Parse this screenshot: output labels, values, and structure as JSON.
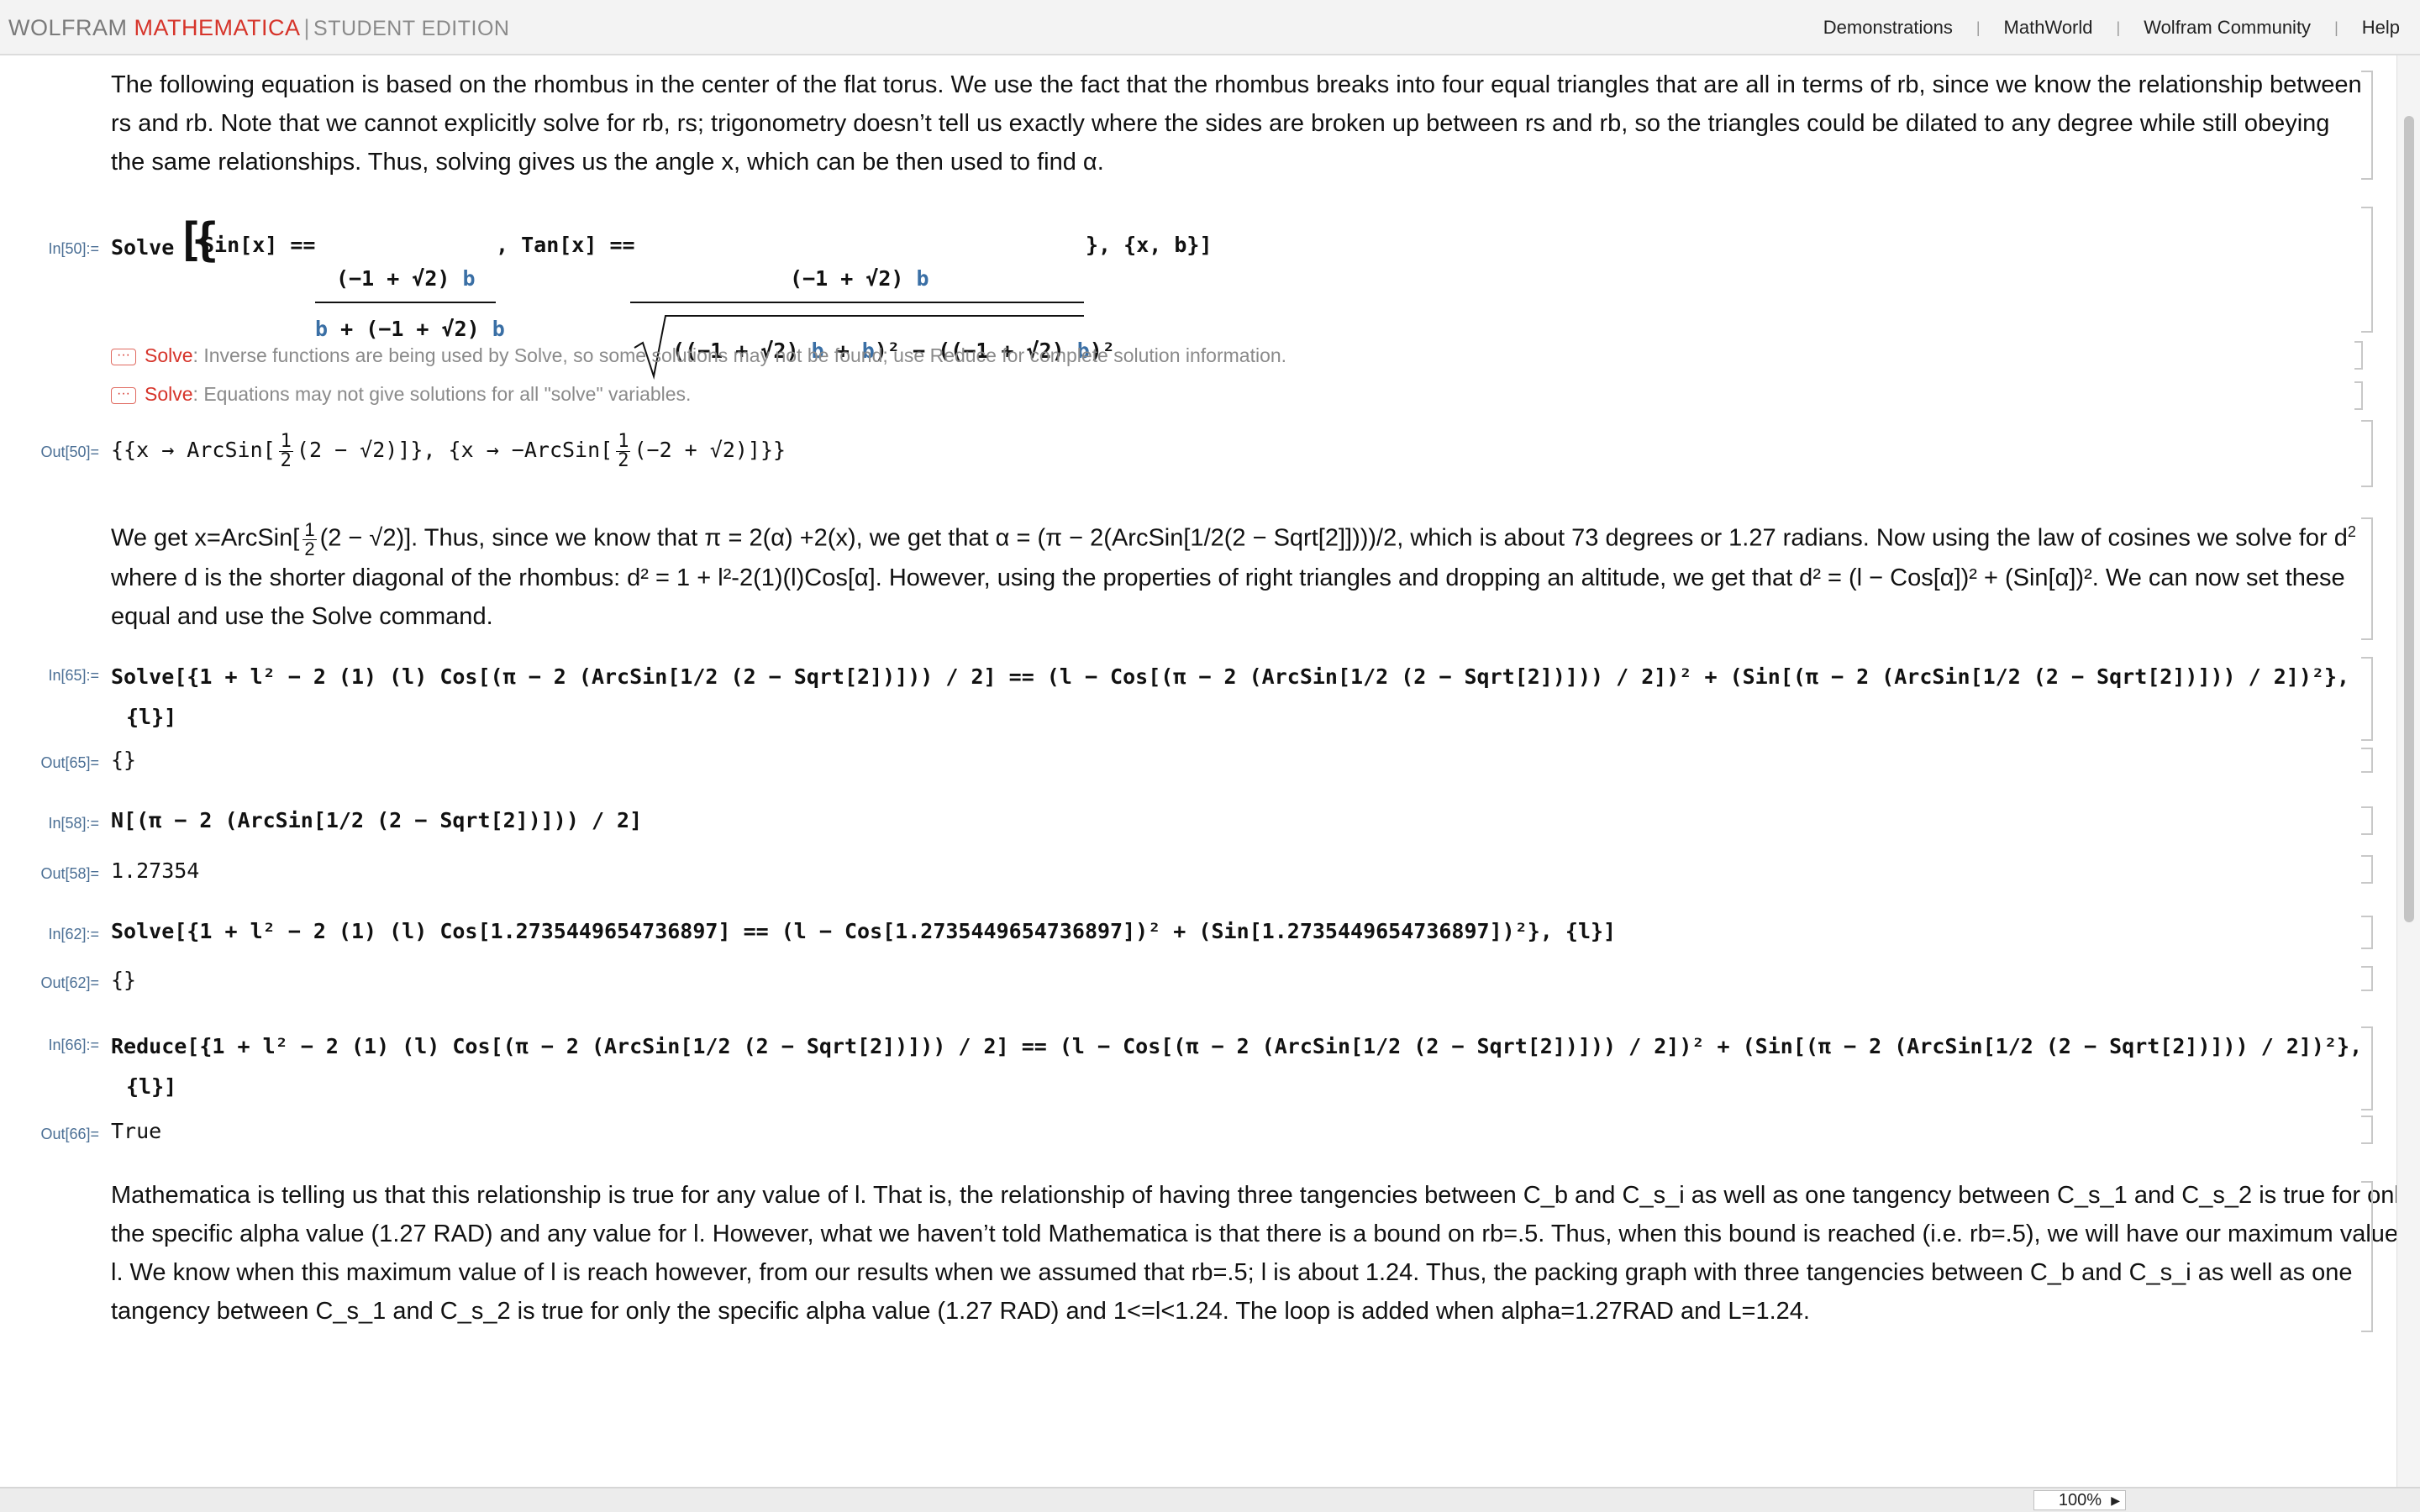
{
  "topbar": {
    "brand_wolfram": "WOLFRAM",
    "brand_mathematica": "MATHEMATICA",
    "brand_separator": "|",
    "brand_edition": "STUDENT EDITION",
    "links": [
      "Demonstrations",
      "MathWorld",
      "Wolfram Community",
      "Help"
    ],
    "link_separator": "|"
  },
  "cells": {
    "intro_text": "The following equation is based on the rhombus in the center of the flat torus.  We use the fact that the rhombus breaks into four equal triangles that are all in terms of rb, since we know the relationship between rs and rb.  Note that we cannot explicitly solve for rb, rs; trigonometry doesn’t tell us exactly where the sides are broken up between rs and rb, so the triangles could be dilated to any degree while still obeying the same relationships.  Thus, solving gives us the angle x, which can be then used to find α.",
    "in50_label": "In[50]:=",
    "in50": {
      "head": "Solve",
      "sin_lhs": "Sin[x] ==",
      "tan_lhs": ", Tan[x] ==",
      "vars": "}, {x, b}]"
    },
    "msg1_fn": "Solve",
    "msg1": ": Inverse functions are being used by Solve, so some solutions may not be found; use Reduce for complete solution information.",
    "msg2_fn": "Solve",
    "msg2": ": Equations may not give solutions for all \"solve\" variables.",
    "msg_dots": "···",
    "out50_label": "Out[50]=",
    "out50": {
      "part1": "{{x → ArcSin[",
      "part2": "(2 − √2)]}, {x → −ArcSin[",
      "part3": "(−2 + √2)]}}",
      "half_num": "1",
      "half_den": "2"
    },
    "text2_l1_a": "We get x=ArcSin[",
    "text2_l1_b": "(2 − √2)]. Thus, since we know that π = 2(α) +2(x), we get that α = (π − 2(ArcSin[1/2(2 − Sqrt[2]])))/2, which is about 73 degrees or 1.27 radians.  Now using the law of cosines we solve for d",
    "text2_l2": "where d is the shorter diagonal of the rhombus: d² = 1 + l²-2(1)(l)Cos[α].  However, using the properties of right triangles and dropping an altitude, we get that d² = (l − Cos[α])² + (Sin[α])².  We can now set these",
    "text2_l3": "equal and use the Solve command.",
    "sup2": "2",
    "in65_label": "In[65]:=",
    "in65_l1": "Solve[{1 + l² − 2 (1) (l) Cos[(π − 2 (ArcSin[1/2 (2 − Sqrt[2])])) / 2] == (l − Cos[(π − 2 (ArcSin[1/2 (2 − Sqrt[2])])) / 2])² + (Sin[(π − 2 (ArcSin[1/2 (2 − Sqrt[2])])) / 2])²},",
    "in65_l2": "{l}]",
    "out65_label": "Out[65]=",
    "out65": "{}",
    "in58_label": "In[58]:=",
    "in58": "N[(π − 2 (ArcSin[1/2 (2 − Sqrt[2])])) / 2]",
    "out58_label": "Out[58]=",
    "out58": "1.27354",
    "in62_label": "In[62]:=",
    "in62": "Solve[{1 + l² − 2 (1) (l) Cos[1.2735449654736897] == (l − Cos[1.2735449654736897])² + (Sin[1.2735449654736897])²}, {l}]",
    "out62_label": "Out[62]=",
    "out62": "{}",
    "in66_label": "In[66]:=",
    "in66_l1": "Reduce[{1 + l² − 2 (1) (l) Cos[(π − 2 (ArcSin[1/2 (2 − Sqrt[2])])) / 2] == (l − Cos[(π − 2 (ArcSin[1/2 (2 − Sqrt[2])])) / 2])² + (Sin[(π − 2 (ArcSin[1/2 (2 − Sqrt[2])])) / 2])²},",
    "in66_l2": "{l}]",
    "out66_label": "Out[66]=",
    "out66": "True",
    "final_text_l1": "Mathematica is telling us that this relationship is true for any value of l.  That is, the relationship of having three tangencies between C_b and C_s_i  as well as one tangency between C_s_1 and C_s_2 is true for only",
    "final_text_l2": "the specific alpha value (1.27 RAD) and any value for l.  However, what we haven’t told Mathematica is that there is a bound on rb=.5.  Thus, when this bound is reached (i.e. rb=.5), we will have our maximum value of",
    "final_text_l3": "l.  We know when this maximum value of l is reach however, from our results when we assumed that rb=.5; l is about 1.24.  Thus, the packing graph with three tangencies between C_b and C_s_i  as well as one",
    "final_text_l4": "tangency between C_s_1 and C_s_2 is true for only the specific alpha value (1.27 RAD) and 1<=l<1.24. The loop is added when alpha=1.27RAD and L=1.24."
  },
  "statusbar": {
    "zoom": "100%",
    "zoom_arrow": "▶"
  },
  "colors": {
    "brand_red": "#d6342a",
    "label_blue": "#4b6f95",
    "variable_blue": "#3a6fa5"
  }
}
